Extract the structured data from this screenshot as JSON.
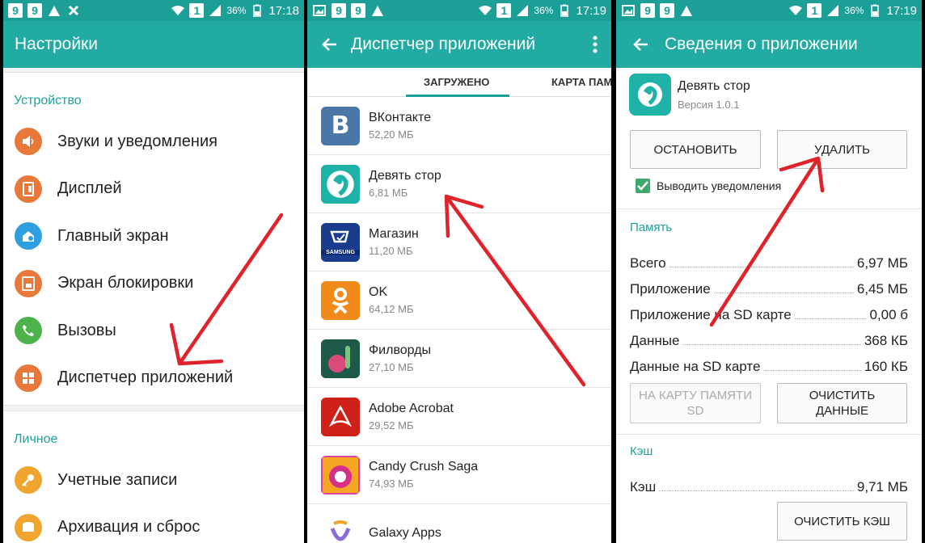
{
  "status_bar": {
    "badge": "9",
    "battery_pct": "36%",
    "network": "1",
    "times": [
      "17:18",
      "17:19",
      "17:19"
    ]
  },
  "settings": {
    "title": "Настройки",
    "section_device": "Устройство",
    "items": [
      {
        "label": "Звуки и уведомления",
        "color": "#e8793a",
        "icon": "speaker-icon"
      },
      {
        "label": "Дисплей",
        "color": "#e8793a",
        "icon": "display-icon"
      },
      {
        "label": "Главный экран",
        "color": "#2ea0e0",
        "icon": "home-screen-icon"
      },
      {
        "label": "Экран блокировки",
        "color": "#e8793a",
        "icon": "lock-screen-icon"
      },
      {
        "label": "Вызовы",
        "color": "#4cb34a",
        "icon": "phone-icon"
      },
      {
        "label": "Диспетчер приложений",
        "color": "#e8793a",
        "icon": "apps-grid-icon"
      }
    ],
    "section_personal": "Личное",
    "personal_items": [
      {
        "label": "Учетные записи",
        "color": "#f0a52e",
        "icon": "key-icon"
      },
      {
        "label": "Архивация и сброс",
        "color": "#f0a52e",
        "icon": "backup-icon"
      }
    ]
  },
  "app_manager": {
    "title": "Диспетчер приложений",
    "tab_downloaded": "ЗАГРУЖЕНО",
    "tab_sd": "КАРТА ПАМ",
    "apps": [
      {
        "name": "ВКонтакте",
        "size": "52,20 МБ",
        "icon": "vk-icon",
        "color": "#4a76a8",
        "glyph": "B"
      },
      {
        "name": "Девять стор",
        "size": "6,81 МБ",
        "icon": "nine-store-icon",
        "color": "#1fb2a8",
        "glyph": "9"
      },
      {
        "name": "Магазин",
        "size": "11,20 МБ",
        "icon": "samsung-store-icon",
        "color": "#1a3c8f",
        "glyph": "SAMSUNG"
      },
      {
        "name": "OK",
        "size": "64,12 МБ",
        "icon": "odnoklassniki-icon",
        "color": "#f28a1b",
        "glyph": "ok"
      },
      {
        "name": "Филворды",
        "size": "27,10 МБ",
        "icon": "filwords-icon",
        "color": "#1d5a4a",
        "glyph": ""
      },
      {
        "name": "Adobe Acrobat",
        "size": "29,52 МБ",
        "icon": "adobe-acrobat-icon",
        "color": "#d0201a",
        "glyph": "A"
      },
      {
        "name": "Candy Crush Saga",
        "size": "74,93 МБ",
        "icon": "candy-crush-icon",
        "color": "#e0439b",
        "glyph": ""
      },
      {
        "name": "Galaxy Apps",
        "size": "",
        "icon": "galaxy-apps-icon",
        "color": "#ffffff",
        "glyph": ""
      }
    ]
  },
  "app_info": {
    "title": "Сведения о приложении",
    "app_name": "Девять стор",
    "version": "Версия 1.0.1",
    "btn_stop": "ОСТАНОВИТЬ",
    "btn_delete": "УДАЛИТЬ",
    "show_notifications": "Выводить уведомления",
    "section_memory": "Память",
    "memory": [
      {
        "label": "Всего",
        "value": "6,97 МБ"
      },
      {
        "label": "Приложение",
        "value": "6,45 МБ"
      },
      {
        "label": "Приложение на SD карте",
        "value": "0,00 б"
      },
      {
        "label": "Данные",
        "value": "368 КБ"
      },
      {
        "label": "Данные на SD карте",
        "value": "160 КБ"
      }
    ],
    "btn_move_sd": "НА КАРТУ ПАМЯТИ SD",
    "btn_clear_data": "ОЧИСТИТЬ ДАННЫЕ",
    "section_cache": "Кэш",
    "cache_label": "Кэш",
    "cache_value": "9,71 МБ",
    "btn_clear_cache": "ОЧИСТИТЬ КЭШ"
  },
  "colors": {
    "statusbar": "#1c9f97",
    "actionbar": "#22aba2",
    "accent": "#1aa39a",
    "arrow": "#e0222a"
  }
}
